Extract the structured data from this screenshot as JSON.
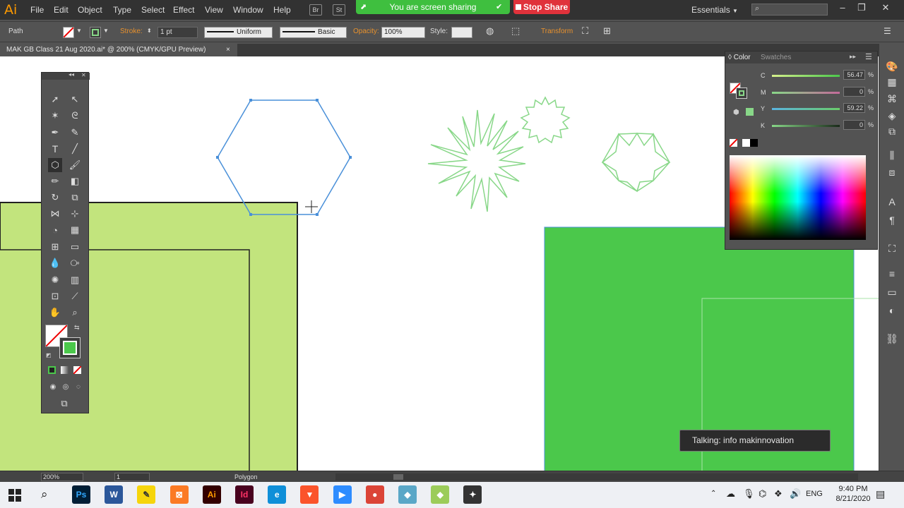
{
  "app": {
    "logo": "Ai"
  },
  "menu": [
    "File",
    "Edit",
    "Object",
    "Type",
    "Select",
    "Effect",
    "View",
    "Window",
    "Help"
  ],
  "menu_buttons": [
    "Br",
    "St"
  ],
  "share": {
    "status": "You are screen sharing",
    "stop_label": "Stop Share"
  },
  "workspace": "Essentials",
  "control_bar": {
    "selection": "Path",
    "stroke_label": "Stroke:",
    "stroke_weight": "1 pt",
    "profile": "Uniform",
    "brush": "Basic",
    "opacity_label": "Opacity:",
    "opacity_value": "100%",
    "style_label": "Style:",
    "transform_label": "Transform"
  },
  "document_tab": {
    "title": "MAK GB Class 21 Aug 2020.ai* @ 200% (CMYK/GPU Preview)",
    "close": "×"
  },
  "color_panel": {
    "tabs": [
      "Color",
      "Swatches"
    ],
    "sliders": [
      {
        "label": "C",
        "value": "56.47",
        "unit": "%"
      },
      {
        "label": "M",
        "value": "0",
        "unit": "%"
      },
      {
        "label": "Y",
        "value": "59.22",
        "unit": "%"
      },
      {
        "label": "K",
        "value": "0",
        "unit": "%"
      }
    ]
  },
  "status_bar": {
    "zoom": "200%",
    "artboard": "1",
    "tool": "Polygon"
  },
  "talking": "Talking: info makinnovation",
  "taskbar": {
    "lang": "ENG",
    "time": "9:40 PM",
    "date": "8/21/2020",
    "apps": [
      {
        "name": "photoshop-icon",
        "label": "Ps",
        "color": "#001e36",
        "fg": "#31a8ff"
      },
      {
        "name": "word-icon",
        "label": "W",
        "color": "#2b579a",
        "fg": "#ffffff"
      },
      {
        "name": "sticky-notes-icon",
        "label": "✎",
        "color": "#f6d50b",
        "fg": "#333333"
      },
      {
        "name": "xampp-icon",
        "label": "⊠",
        "color": "#fb7a24",
        "fg": "#ffffff"
      },
      {
        "name": "illustrator-icon",
        "label": "Ai",
        "color": "#330000",
        "fg": "#ff9a00"
      },
      {
        "name": "indesign-icon",
        "label": "Id",
        "color": "#49021f",
        "fg": "#ff3366"
      },
      {
        "name": "edge-icon",
        "label": "e",
        "color": "#0f8fd8",
        "fg": "#ffffff"
      },
      {
        "name": "brave-icon",
        "label": "▼",
        "color": "#fb542b",
        "fg": "#ffffff"
      },
      {
        "name": "zoom-icon",
        "label": "▶",
        "color": "#2d8cff",
        "fg": "#ffffff"
      },
      {
        "name": "chrome-icon",
        "label": "●",
        "color": "#db4437",
        "fg": "#ffffff"
      },
      {
        "name": "app-icon-1",
        "label": "◆",
        "color": "#5aa7c7",
        "fg": "#ffffff"
      },
      {
        "name": "app-icon-2",
        "label": "◆",
        "color": "#9ccc5a",
        "fg": "#ffffff"
      },
      {
        "name": "app-icon-3",
        "label": "✦",
        "color": "#333333",
        "fg": "#ffffff"
      }
    ]
  },
  "colors": {
    "green_fill": "#4bc84b",
    "light_green": "#c2e47d",
    "shape_stroke": "#88d788",
    "selection": "#4a90d9"
  }
}
